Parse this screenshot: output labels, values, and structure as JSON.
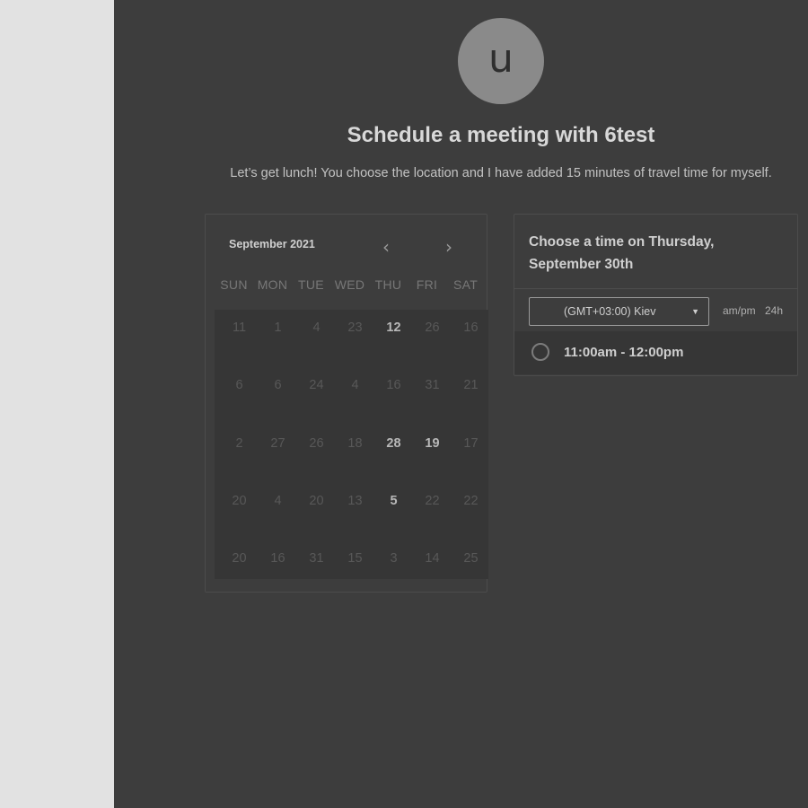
{
  "profile": {
    "avatar_initial": "u",
    "title": "Schedule a meeting with 6test",
    "description": "Let’s get lunch! You choose the location and I have added 15 minutes of travel time for myself."
  },
  "calendar": {
    "month": "September 2021",
    "weekdays": [
      "SUN",
      "MON",
      "TUE",
      "WED",
      "THU",
      "FRI",
      "SAT"
    ],
    "weeks": [
      [
        {
          "d": "11",
          "a": false
        },
        {
          "d": "1",
          "a": false
        },
        {
          "d": "4",
          "a": false
        },
        {
          "d": "23",
          "a": false
        },
        {
          "d": "12",
          "a": true
        },
        {
          "d": "26",
          "a": false
        },
        {
          "d": "16",
          "a": false
        }
      ],
      [
        {
          "d": "6",
          "a": false
        },
        {
          "d": "6",
          "a": false
        },
        {
          "d": "24",
          "a": false
        },
        {
          "d": "4",
          "a": false
        },
        {
          "d": "16",
          "a": false
        },
        {
          "d": "31",
          "a": false
        },
        {
          "d": "21",
          "a": false
        }
      ],
      [
        {
          "d": "2",
          "a": false
        },
        {
          "d": "27",
          "a": false
        },
        {
          "d": "26",
          "a": false
        },
        {
          "d": "18",
          "a": false
        },
        {
          "d": "28",
          "a": true
        },
        {
          "d": "19",
          "a": true
        },
        {
          "d": "17",
          "a": false
        }
      ],
      [
        {
          "d": "20",
          "a": false
        },
        {
          "d": "4",
          "a": false
        },
        {
          "d": "20",
          "a": false
        },
        {
          "d": "13",
          "a": false
        },
        {
          "d": "5",
          "a": true
        },
        {
          "d": "22",
          "a": false
        },
        {
          "d": "22",
          "a": false
        }
      ],
      [
        {
          "d": "20",
          "a": false
        },
        {
          "d": "16",
          "a": false
        },
        {
          "d": "31",
          "a": false
        },
        {
          "d": "15",
          "a": false
        },
        {
          "d": "3",
          "a": false
        },
        {
          "d": "14",
          "a": false
        },
        {
          "d": "25",
          "a": false
        }
      ]
    ]
  },
  "icons": {
    "prev": "chevron-left-icon",
    "next": "chevron-right-icon",
    "dropdown": "caret-down-icon",
    "slot": "radio-icon"
  },
  "time_panel": {
    "heading_line1": "Choose a time on Thursday,",
    "heading_line2": "September 30th",
    "timezone": "(GMT+03:00) Kiev",
    "format_ampm": "am/pm",
    "format_24h": "24h",
    "slots": [
      "11:00am - 12:00pm"
    ]
  }
}
